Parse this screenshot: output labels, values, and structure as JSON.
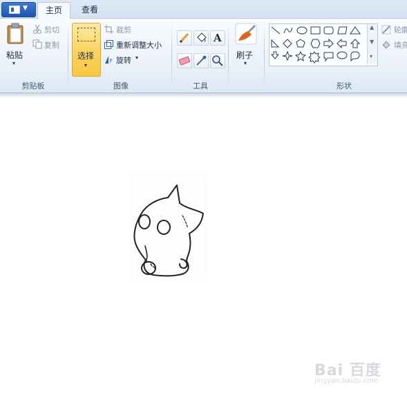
{
  "tabs": {
    "home": "主页",
    "view": "查看"
  },
  "clipboard": {
    "paste": "粘贴",
    "cut": "剪切",
    "copy": "复制",
    "group": "剪贴板"
  },
  "image": {
    "select": "选择",
    "crop": "裁剪",
    "resize": "重新调整大小",
    "rotate": "旋转",
    "group": "图像"
  },
  "tools": {
    "group": "工具"
  },
  "brushes": {
    "label": "刷子"
  },
  "shapes": {
    "group": "形状",
    "outline": "轮廓",
    "fill": "填充"
  },
  "watermark": {
    "main": "Bai 百度",
    "sub": "jingyan.baidu.com"
  },
  "colors": {
    "ribbon": "#edf3fa",
    "select_highlight": "#fbd35d",
    "file_button": "#2b64bf"
  },
  "icons": [
    "paste-icon",
    "cut-icon",
    "copy-icon",
    "select-icon",
    "crop-icon",
    "resize-icon",
    "rotate-icon",
    "pencil-icon",
    "fill-icon",
    "text-icon",
    "eraser-icon",
    "color-picker-icon",
    "magnifier-icon",
    "brush-icon",
    "outline-icon",
    "fill-shape-icon"
  ]
}
